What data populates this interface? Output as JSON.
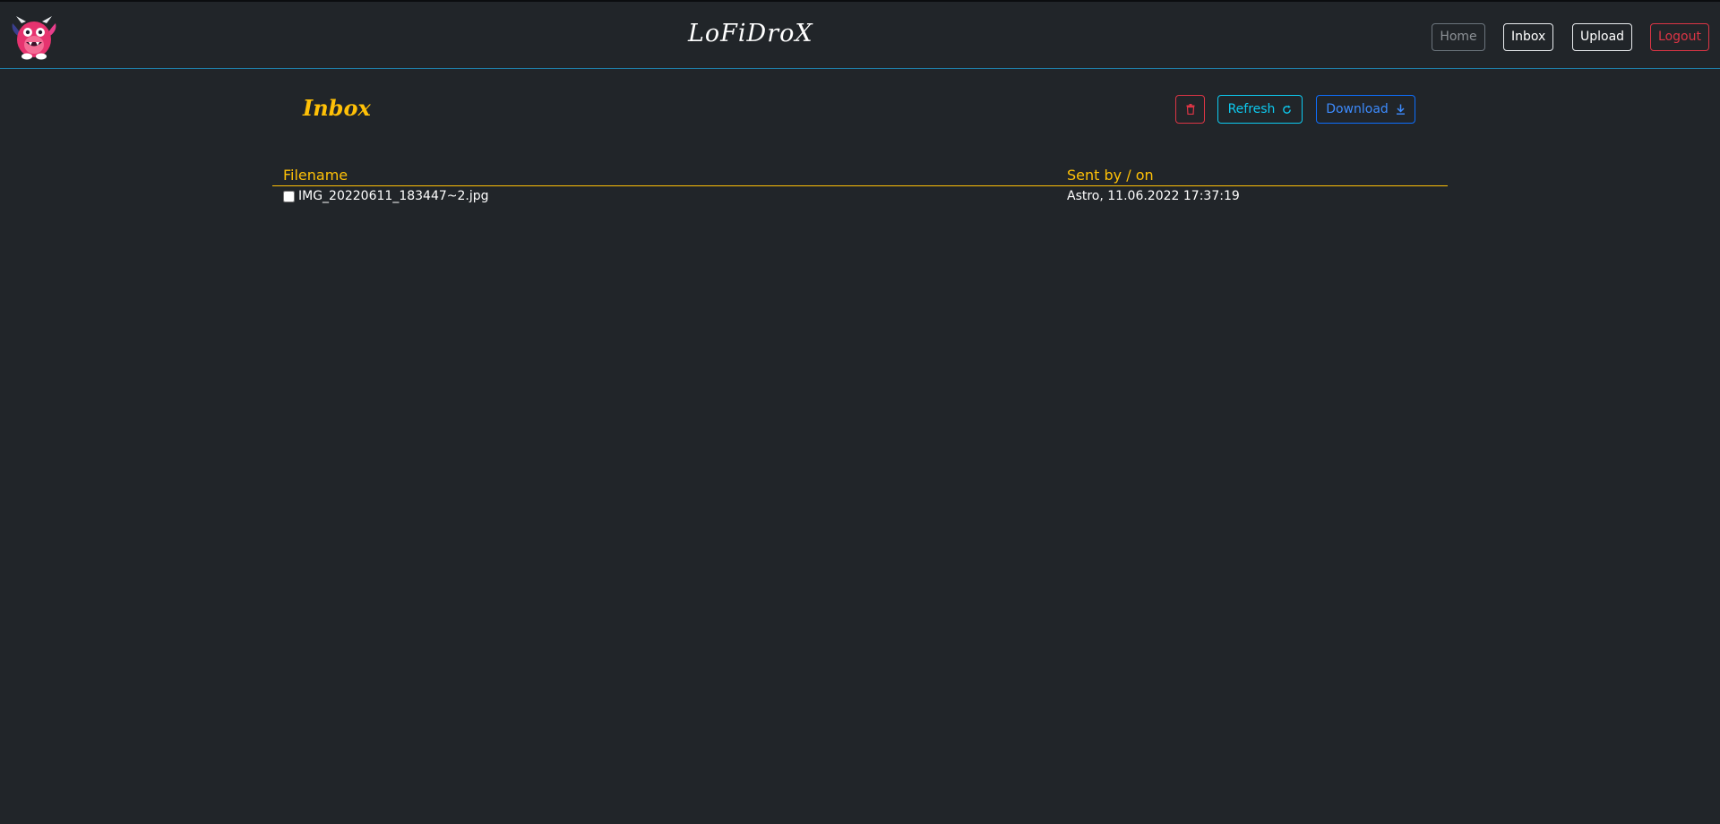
{
  "header": {
    "brand": "LoFiDroX",
    "logo_icon": "pink-monster-mascot-icon",
    "nav": {
      "home": "Home",
      "inbox": "Inbox",
      "upload": "Upload",
      "logout": "Logout"
    }
  },
  "main": {
    "title": "Inbox",
    "actions": {
      "delete_icon": "trash-icon",
      "refresh_label": "Refresh",
      "refresh_icon": "refresh-icon",
      "download_label": "Download",
      "download_icon": "download-icon"
    },
    "table": {
      "columns": [
        "Filename",
        "Sent by / on"
      ],
      "rows": [
        {
          "filename": "IMG_20220611_183447~2.jpg",
          "sent": "Astro, 11.06.2022 17:37:19",
          "checked": false
        }
      ]
    }
  },
  "colors": {
    "background": "#212529",
    "accent_yellow": "#ffc107",
    "danger": "#dc3545",
    "info": "#0dcaf0",
    "primary": "#0d6efd",
    "header_border": "#1f7fa8"
  }
}
